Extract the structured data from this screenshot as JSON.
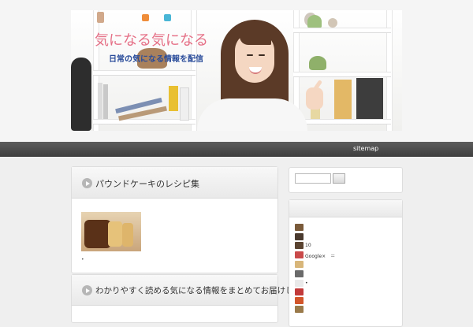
{
  "header": {
    "site_title": "気になる気になる",
    "site_description": "日常の気になる情報を配信"
  },
  "nav": {
    "items": [
      {
        "label": "sitemap"
      }
    ]
  },
  "main": {
    "posts": [
      {
        "title": "パウンドケーキのレシピ集",
        "thumbnail": "pound-cake-photo",
        "bullet": "•"
      },
      {
        "title": "わかりやすく読める気になる情報をまとめてお届けします"
      }
    ]
  },
  "sidebar": {
    "search": {
      "value": "",
      "button_label": ""
    },
    "recent": [
      {
        "label": ""
      },
      {
        "label": ""
      },
      {
        "label": "10"
      },
      {
        "label": "Google×　＝"
      },
      {
        "label": ""
      },
      {
        "label": ""
      },
      {
        "label": "•"
      },
      {
        "label": ""
      },
      {
        "label": ""
      },
      {
        "label": ""
      }
    ],
    "thumb_colors": [
      "#7a5a3a",
      "#4a3a2e",
      "#5a4330",
      "#c94a4a",
      "#d8b67a",
      "#6a6a6a",
      "#e9e9e9",
      "#c23a3a",
      "#d2552a",
      "#9a7a4a"
    ]
  },
  "colors": {
    "title_pink": "#e56f86",
    "desc_blue": "#2a4c9a",
    "nav_dark": "#4a4a4a",
    "icon_gray": "#b6b6b6"
  }
}
